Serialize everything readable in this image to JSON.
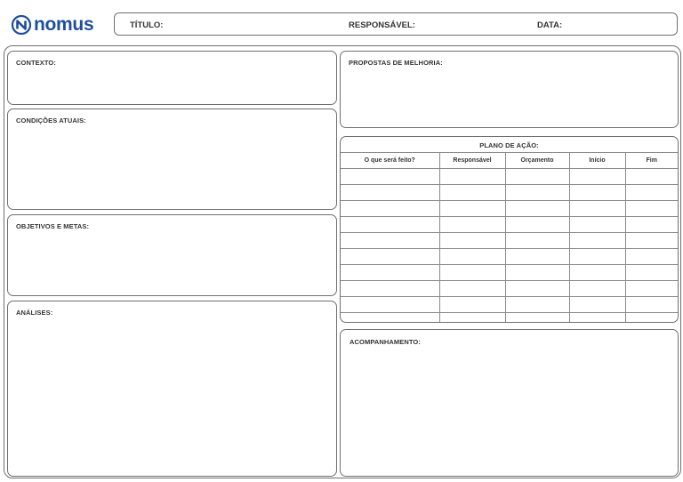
{
  "logo": {
    "text": "nomus",
    "color": "#1f4f9c"
  },
  "header": {
    "title_label": "TÍTULO:",
    "responsible_label": "RESPONSÁVEL:",
    "date_label": "DATA:"
  },
  "sections": {
    "context": "CONTEXTO:",
    "current_conditions": "CONDIÇÕES ATUAIS:",
    "objectives": "OBJETIVOS E METAS:",
    "analyses": "ANÁLISES:",
    "improvement_proposals": "PROPOSTAS DE MELHORIA:",
    "follow_up": "ACOMPANHAMENTO:"
  },
  "action_plan": {
    "title": "PLANO DE AÇÃO:",
    "columns": [
      "O que será feito?",
      "Responsável",
      "Orçamento",
      "Início",
      "Fim"
    ],
    "rows": [
      [
        "",
        "",
        "",
        "",
        ""
      ],
      [
        "",
        "",
        "",
        "",
        ""
      ],
      [
        "",
        "",
        "",
        "",
        ""
      ],
      [
        "",
        "",
        "",
        "",
        ""
      ],
      [
        "",
        "",
        "",
        "",
        ""
      ],
      [
        "",
        "",
        "",
        "",
        ""
      ],
      [
        "",
        "",
        "",
        "",
        ""
      ],
      [
        "",
        "",
        "",
        "",
        ""
      ],
      [
        "",
        "",
        "",
        "",
        ""
      ],
      [
        "",
        "",
        "",
        "",
        ""
      ]
    ]
  }
}
